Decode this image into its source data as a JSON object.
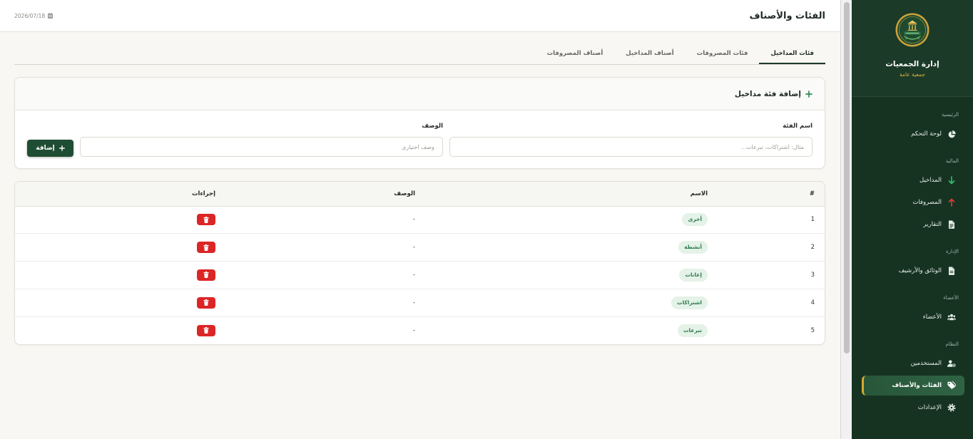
{
  "header": {
    "title": "الفئات والأصناف",
    "date": "2026/07/18",
    "date_icon": "calendar-icon"
  },
  "tabs": [
    {
      "label": "فئات المداخيل",
      "active": true
    },
    {
      "label": "فئات المصروفات",
      "active": false
    },
    {
      "label": "أصناف المداخيل",
      "active": false
    },
    {
      "label": "أصناف المصروفات",
      "active": false
    }
  ],
  "add_form": {
    "title": "إضافة فئة مداخيل",
    "title_icon": "plus-icon",
    "name_label": "اسم الفئة",
    "name_placeholder": "مثال: اشتراكات، تبرعات...",
    "name_value": "",
    "description_label": "الوصف",
    "description_placeholder": "وصف اختياري",
    "description_value": "",
    "submit_label": "إضافة",
    "submit_icon": "plus-icon"
  },
  "table": {
    "columns": {
      "index": "#",
      "name": "الاسم",
      "description": "الوصف",
      "actions": "إجراءات"
    },
    "rows": [
      {
        "index": "1",
        "name": "أخرى",
        "description": "-",
        "action_icon": "trash-icon"
      },
      {
        "index": "2",
        "name": "أنشطة",
        "description": "-",
        "action_icon": "trash-icon"
      },
      {
        "index": "3",
        "name": "إعانات",
        "description": "-",
        "action_icon": "trash-icon"
      },
      {
        "index": "4",
        "name": "اشتراكات",
        "description": "-",
        "action_icon": "trash-icon"
      },
      {
        "index": "5",
        "name": "تبرعات",
        "description": "-",
        "action_icon": "trash-icon"
      }
    ]
  },
  "sidebar": {
    "app_name": "إدارة الجمعيات",
    "org_type": "جمعية عامة",
    "logo_icon": "association-logo",
    "sections": [
      {
        "label": "الرئيسية",
        "items": [
          {
            "label": "لوحة التحكم",
            "icon": "chart-pie-icon"
          }
        ]
      },
      {
        "label": "المالية",
        "items": [
          {
            "label": "المداخيل",
            "icon": "arrow-down-icon"
          },
          {
            "label": "المصروفات",
            "icon": "arrow-up-icon"
          },
          {
            "label": "التقارير",
            "icon": "file-invoice-icon"
          }
        ]
      },
      {
        "label": "الإدارة",
        "items": [
          {
            "label": "الوثائق والأرشيف",
            "icon": "file-icon"
          }
        ]
      },
      {
        "label": "الأعضاء",
        "items": [
          {
            "label": "الأعضاء",
            "icon": "users-icon"
          }
        ]
      },
      {
        "label": "النظام",
        "items": [
          {
            "label": "المستخدمين",
            "icon": "user-cog-icon"
          },
          {
            "label": "الفئات والأصناف",
            "icon": "tags-icon",
            "active": true
          },
          {
            "label": "الإعدادات",
            "icon": "gear-icon"
          }
        ]
      }
    ]
  },
  "colors": {
    "page_bg": "#f8f7f3",
    "sidebar_bg": "#163322",
    "brand_bg": "#1b3a28",
    "accent": "#1f4d33",
    "gold": "#d7aa2f",
    "income": "#34c26b",
    "expense": "#e53935",
    "danger": "#dc2626",
    "badge_bg": "#e4f2e8",
    "badge_text": "#2d7a4b"
  }
}
